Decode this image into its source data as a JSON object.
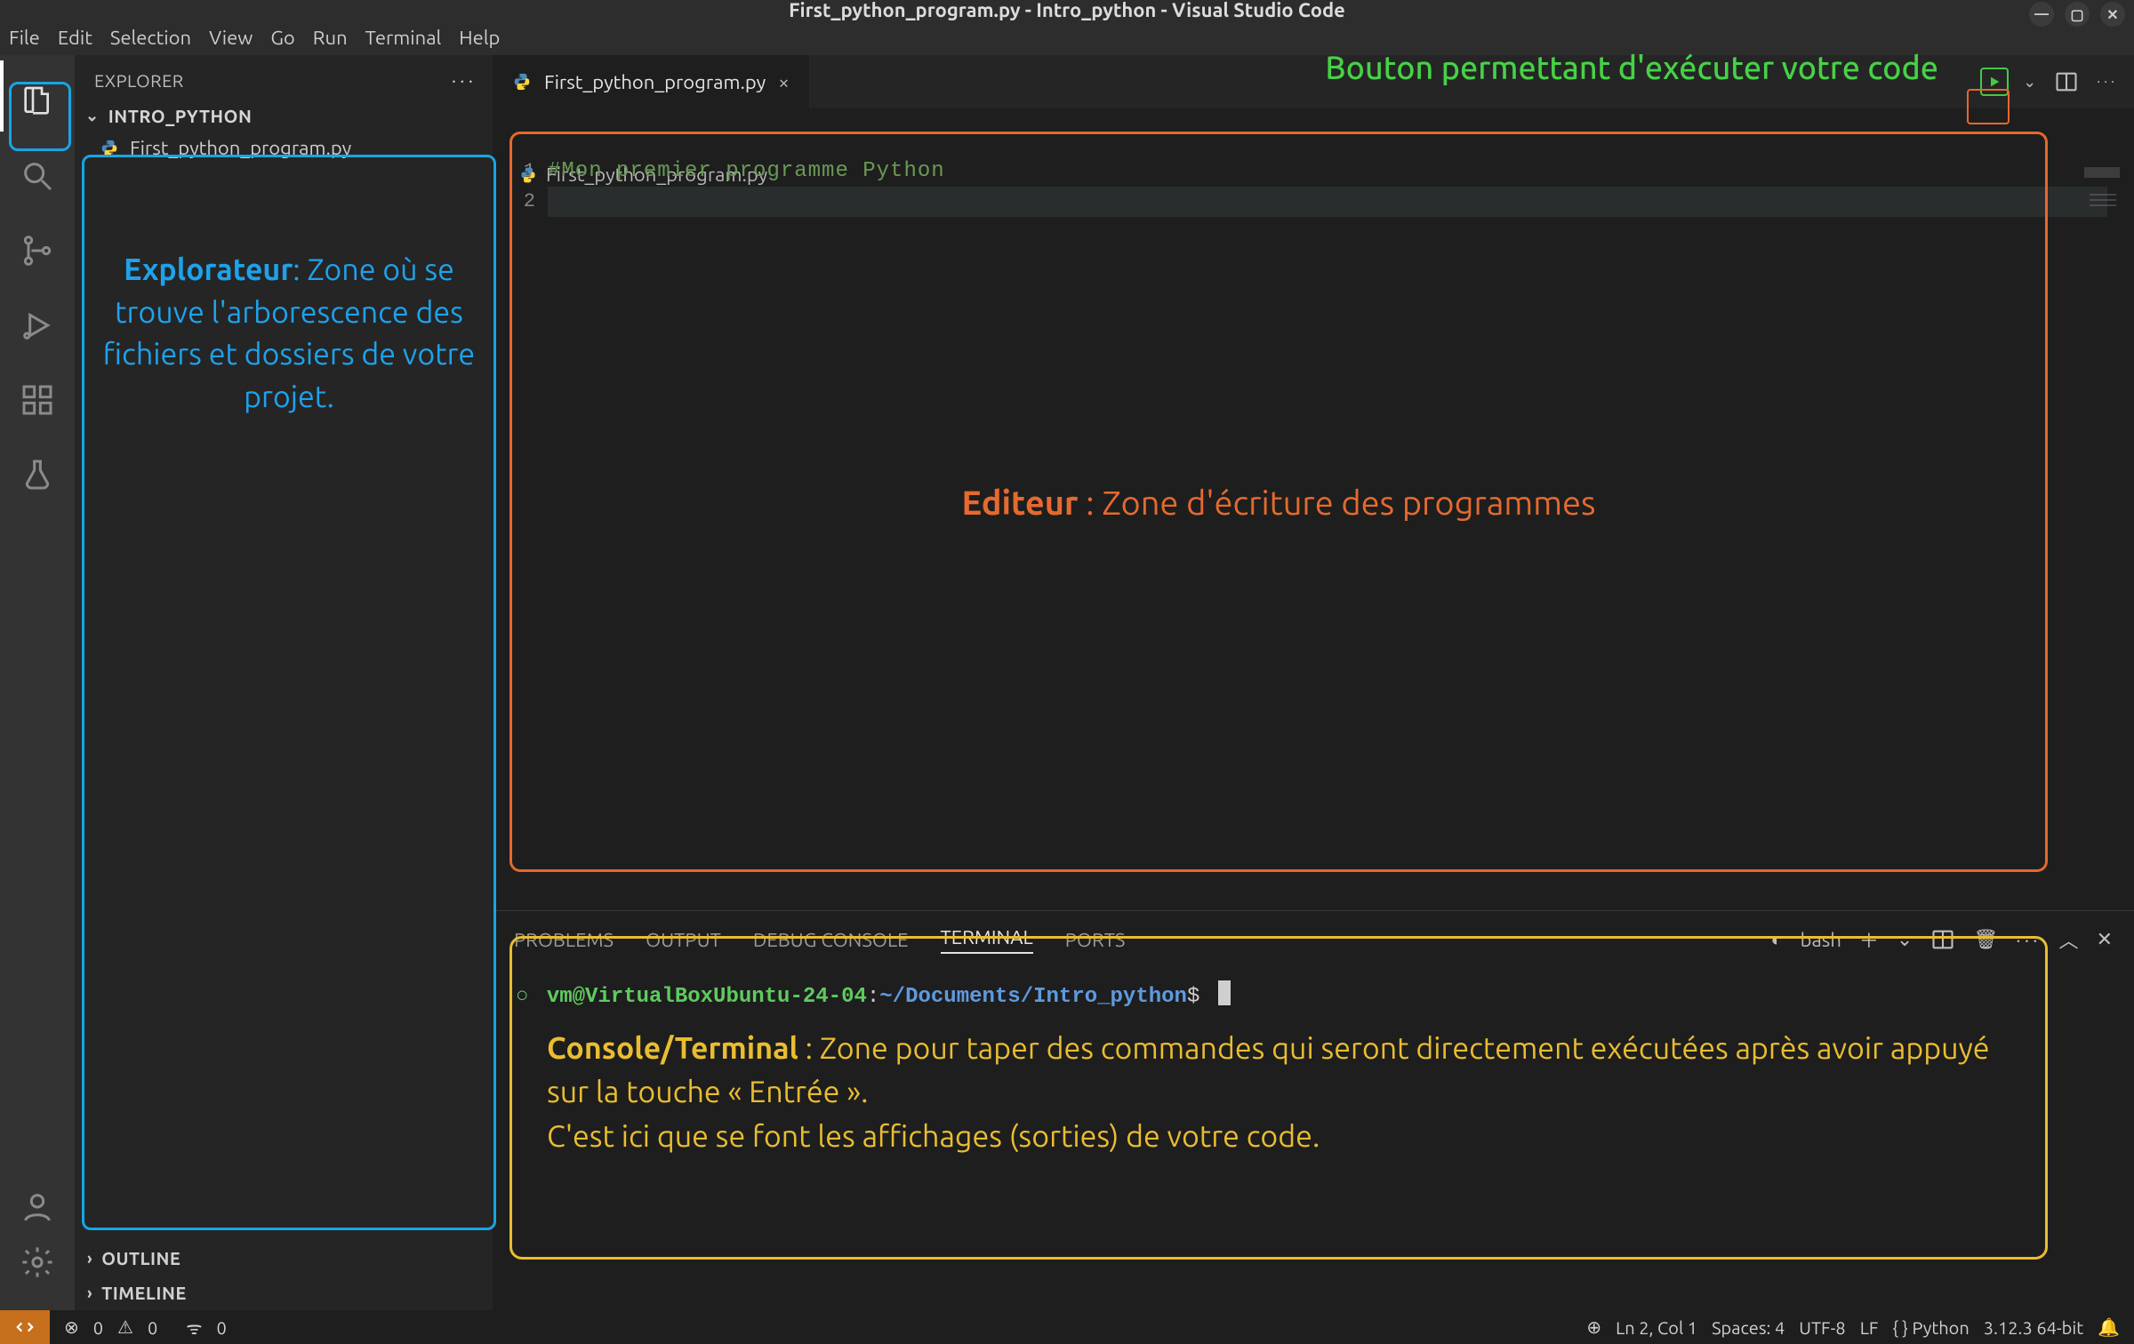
{
  "title": "First_python_program.py - Intro_python - Visual Studio Code",
  "menubar": [
    "File",
    "Edit",
    "Selection",
    "View",
    "Go",
    "Run",
    "Terminal",
    "Help"
  ],
  "sidebar": {
    "title": "EXPLORER",
    "folder": "INTRO_PYTHON",
    "file": "First_python_program.py",
    "outline": "OUTLINE",
    "timeline": "TIMELINE"
  },
  "tab": {
    "label": "First_python_program.py"
  },
  "breadcrumb": "First_python_program.py",
  "editor": {
    "line_numbers": [
      "1",
      "2"
    ],
    "line1": "#Mon premier programme Python"
  },
  "panel": {
    "tabs": {
      "problems": "PROBLEMS",
      "output": "OUTPUT",
      "debug": "DEBUG CONSOLE",
      "terminal": "TERMINAL",
      "ports": "PORTS"
    },
    "shell_label": "bash",
    "prompt_user": "vm@VirtualBoxUbuntu-24-04",
    "prompt_sep": ":",
    "prompt_path": "~/Documents/Intro_python",
    "prompt_dollar": "$"
  },
  "statusbar": {
    "errors": "0",
    "warnings": "0",
    "ports": "0",
    "cursor": "Ln 2, Col 1",
    "spaces": "Spaces: 4",
    "encoding": "UTF-8",
    "eol": "LF",
    "lang": "{ } Python",
    "interp": "3.12.3 64-bit"
  },
  "annotations": {
    "run_button": "Bouton permettant d'exécuter votre code",
    "explorer_title": "Explorateur",
    "explorer_body": ": Zone où se trouve l'arborescence des fichiers et dossiers de votre projet.",
    "editor_title": "Editeur",
    "editor_body": " : Zone d'écriture des programmes",
    "terminal_title": "Console/Terminal",
    "terminal_body1": " : Zone pour taper des commandes qui seront directement exécutées après avoir appuyé sur la touche « Entrée ».",
    "terminal_body2": "C'est ici que se font les affichages (sorties) de votre code."
  }
}
